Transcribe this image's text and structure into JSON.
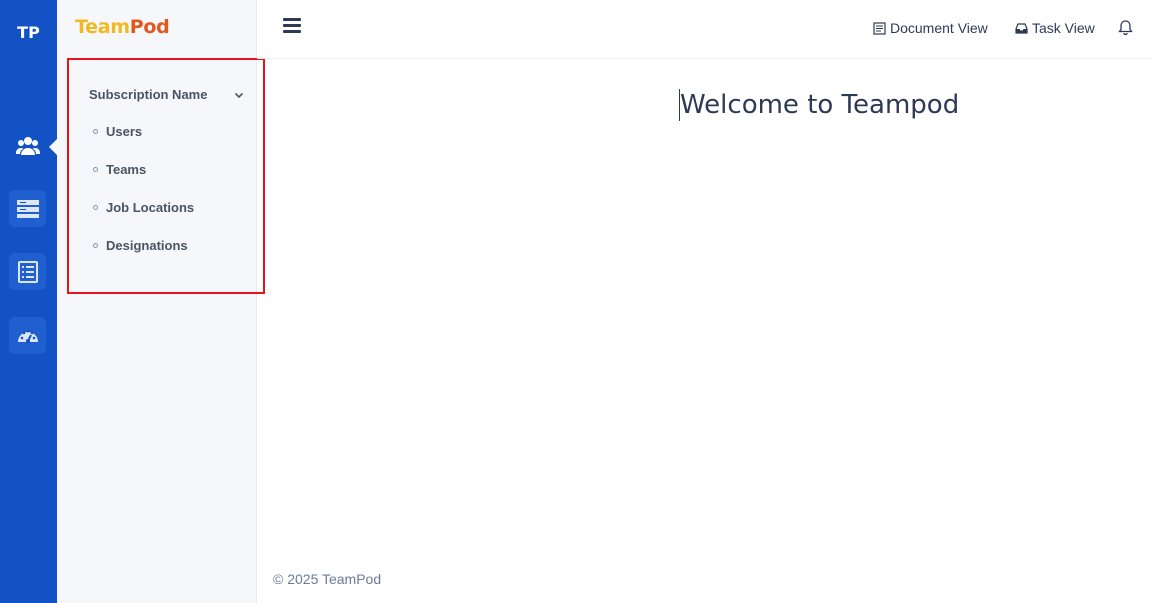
{
  "rail": {
    "brand": "TP",
    "items": [
      {
        "icon": "users-icon",
        "active": true
      },
      {
        "icon": "server-icon",
        "active": false
      },
      {
        "icon": "checklist-icon",
        "active": false
      },
      {
        "icon": "dashboard-gauge-icon",
        "active": false
      }
    ]
  },
  "sidebar": {
    "logo_part1": "Team",
    "logo_part2": "Pod",
    "section_title": "Subscription Name",
    "items": [
      {
        "label": "Users"
      },
      {
        "label": "Teams"
      },
      {
        "label": "Job Locations"
      },
      {
        "label": "Designations"
      }
    ]
  },
  "header": {
    "document_view": "Document View",
    "task_view": "Task View"
  },
  "main": {
    "welcome": "Welcome to Teampod"
  },
  "footer": {
    "text": "© 2025 TeamPod"
  },
  "colors": {
    "rail_bg": "#1352c5",
    "logo_team": "#f2b820",
    "logo_pod": "#e2571c",
    "highlight_border": "#e5141c",
    "text_dark": "#2e3a55"
  }
}
